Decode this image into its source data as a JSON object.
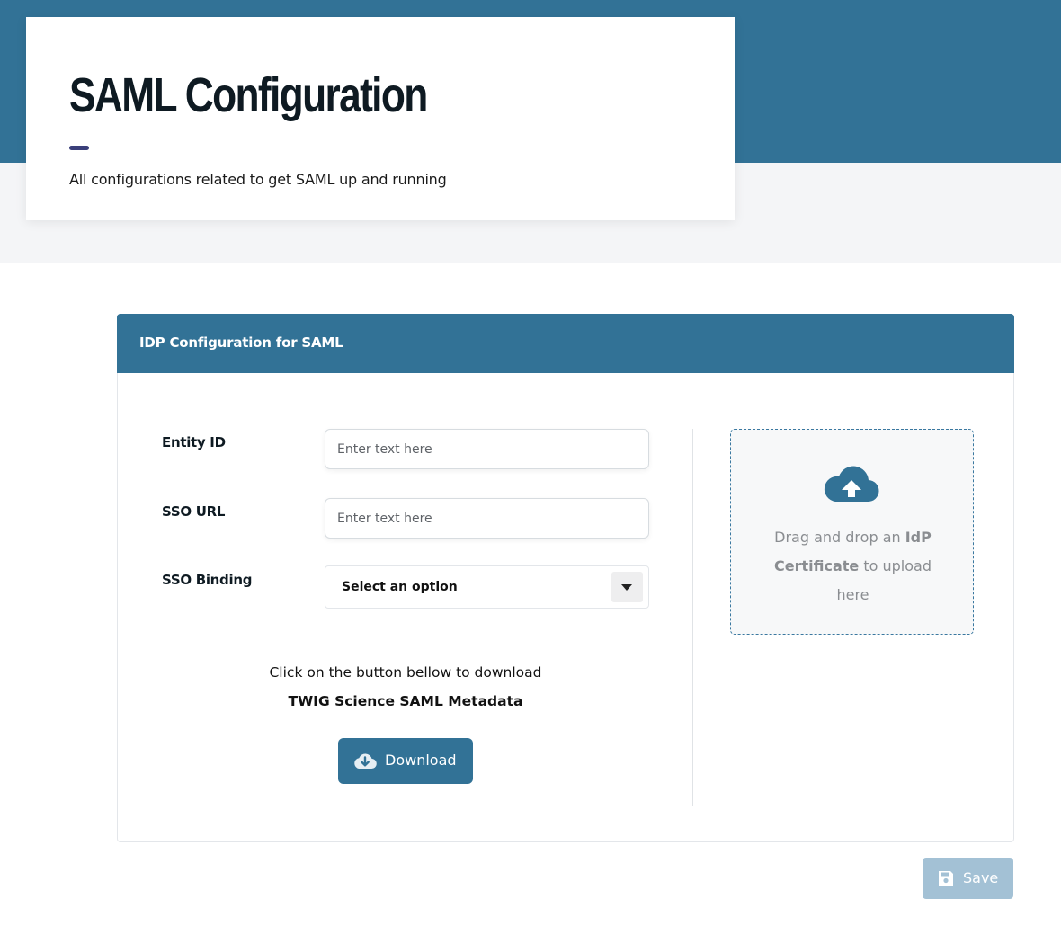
{
  "header": {
    "title": "SAML Configuration",
    "subtitle": "All configurations related to get SAML up and running"
  },
  "panel": {
    "title": "IDP Configuration for SAML",
    "fields": {
      "entity_id": {
        "label": "Entity ID",
        "placeholder": "Enter text here",
        "value": ""
      },
      "sso_url": {
        "label": "SSO URL",
        "placeholder": "Enter text here",
        "value": ""
      },
      "sso_binding": {
        "label": "SSO Binding",
        "selected": "Select an option"
      }
    },
    "download": {
      "line1": "Click on the button bellow to download",
      "line2": "TWIG Science SAML Metadata",
      "button_label": "Download",
      "icon": "cloud-download-icon"
    },
    "dropzone": {
      "text_pre": "Drag and drop an ",
      "text_bold": "IdP Certificate",
      "text_post": " to upload here",
      "icon": "cloud-upload-icon"
    }
  },
  "save": {
    "label": "Save",
    "icon": "floppy-disk-icon"
  },
  "colors": {
    "brand": "#327296",
    "accent": "#3a3f7a",
    "save_disabled": "#a3c1d5"
  }
}
